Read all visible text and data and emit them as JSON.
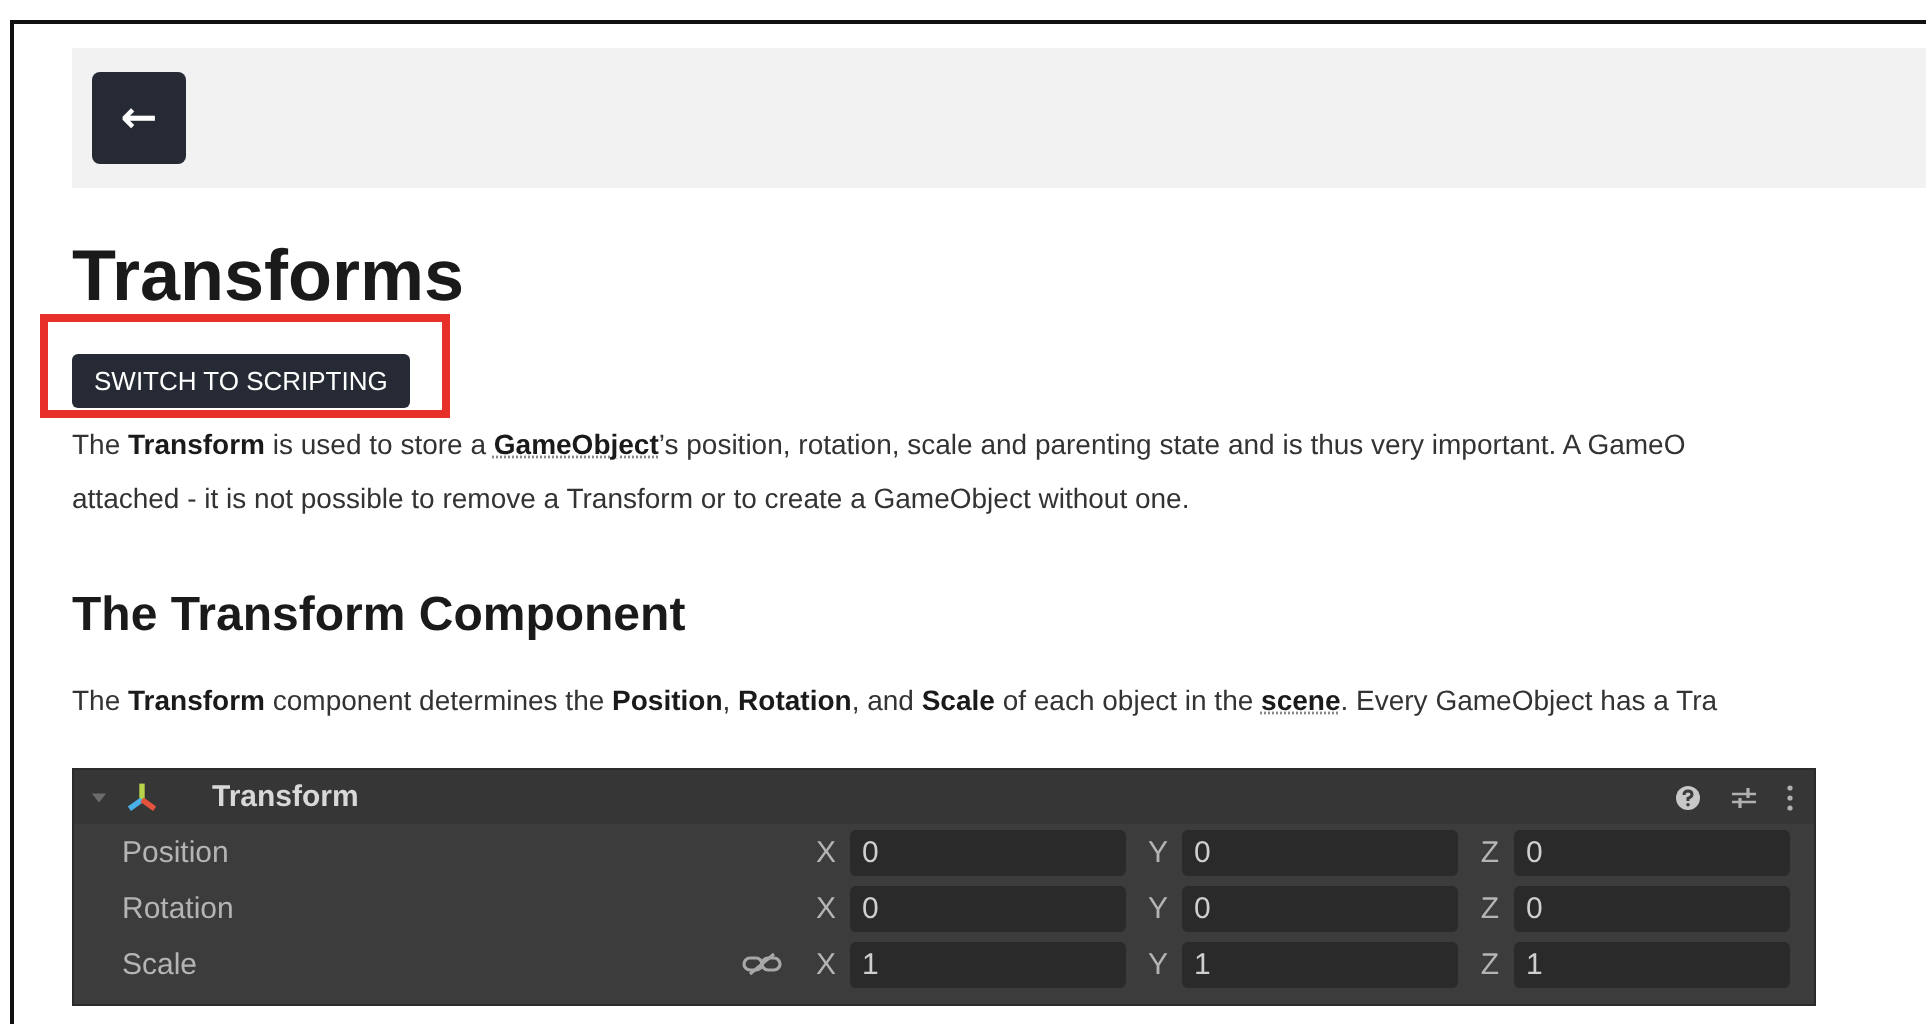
{
  "header": {
    "back_button": "←"
  },
  "title": "Transforms",
  "switch_button": {
    "label": "SWITCH TO SCRIPTING",
    "highlighted": true
  },
  "intro": [
    {
      "kind": "text",
      "text": "The "
    },
    {
      "kind": "bold",
      "text": "Transform"
    },
    {
      "kind": "text",
      "text": " is used to store a "
    },
    {
      "kind": "link",
      "text": "GameObject"
    },
    {
      "kind": "text",
      "text": "’s position, rotation, scale and parenting state and is thus very important. A GameO"
    }
  ],
  "intro_line_2": "attached - it is not possible to remove a Transform or to create a GameObject without one.",
  "section_heading": "The Transform Component",
  "section_text": [
    {
      "kind": "text",
      "text": "The "
    },
    {
      "kind": "bold",
      "text": "Transform"
    },
    {
      "kind": "text",
      "text": " component determines the "
    },
    {
      "kind": "bold",
      "text": "Position"
    },
    {
      "kind": "text",
      "text": ", "
    },
    {
      "kind": "bold",
      "text": "Rotation"
    },
    {
      "kind": "text",
      "text": ", and "
    },
    {
      "kind": "bold",
      "text": "Scale"
    },
    {
      "kind": "text",
      "text": " of each object in the "
    },
    {
      "kind": "link",
      "text": "scene"
    },
    {
      "kind": "text",
      "text": ". Every GameObject has a Tra"
    }
  ],
  "inspector": {
    "title": "Transform",
    "expanded": true,
    "rows": [
      {
        "label": "Position",
        "linked": false,
        "axes": [
          {
            "axis": "X",
            "value": "0"
          },
          {
            "axis": "Y",
            "value": "0"
          },
          {
            "axis": "Z",
            "value": "0"
          }
        ]
      },
      {
        "label": "Rotation",
        "linked": false,
        "axes": [
          {
            "axis": "X",
            "value": "0"
          },
          {
            "axis": "Y",
            "value": "0"
          },
          {
            "axis": "Z",
            "value": "0"
          }
        ]
      },
      {
        "label": "Scale",
        "linked": true,
        "axes": [
          {
            "axis": "X",
            "value": "1"
          },
          {
            "axis": "Y",
            "value": "1"
          },
          {
            "axis": "Z",
            "value": "1"
          }
        ]
      }
    ]
  }
}
